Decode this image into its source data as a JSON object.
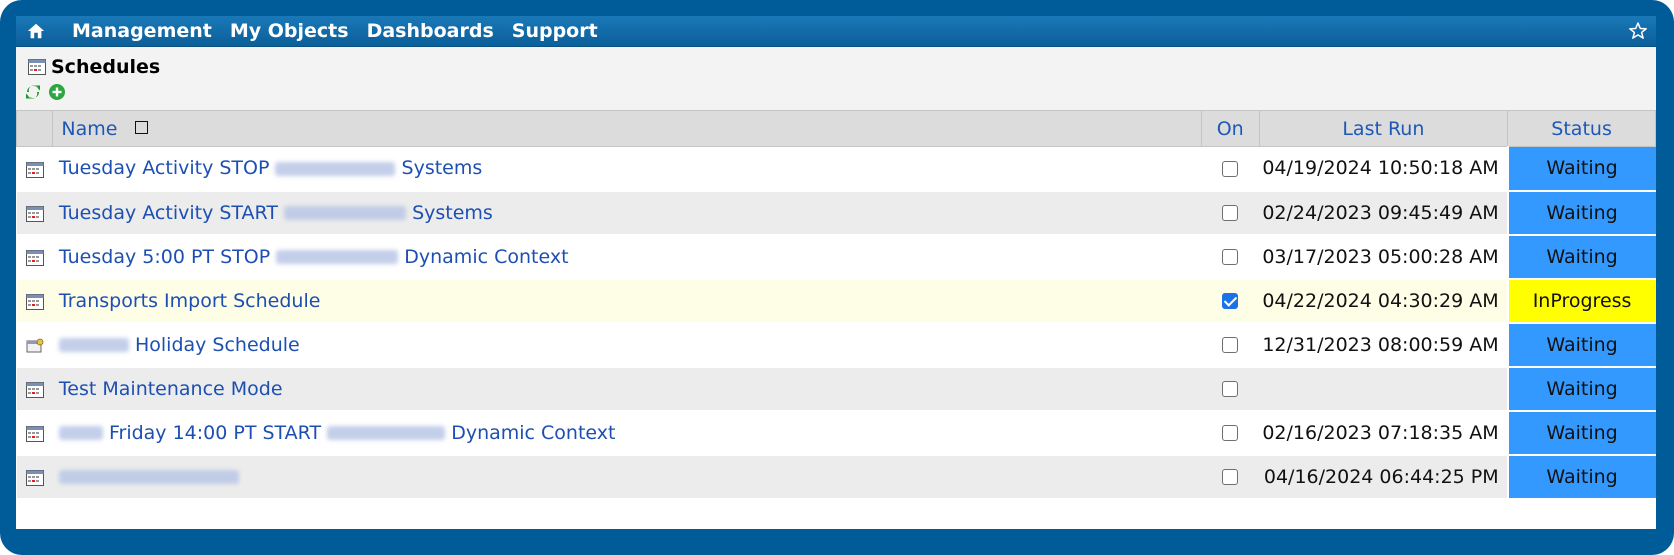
{
  "nav": {
    "items": [
      "Management",
      "My Objects",
      "Dashboards",
      "Support"
    ]
  },
  "page": {
    "title": "Schedules"
  },
  "table": {
    "headers": {
      "name": "Name",
      "on": "On",
      "last_run": "Last Run",
      "status": "Status"
    },
    "rows": [
      {
        "name_before": "Tuesday Activity STOP",
        "name_after": "Systems",
        "on": false,
        "last_run": "04/19/2024 10:50:18 AM",
        "status": "Waiting",
        "icon": "calendar-icon"
      },
      {
        "name_before": "Tuesday Activity START",
        "name_after": "Systems",
        "on": false,
        "last_run": "02/24/2023 09:45:49 AM",
        "status": "Waiting",
        "icon": "calendar-icon"
      },
      {
        "name_before": "Tuesday 5:00 PT STOP",
        "name_after": "Dynamic Context",
        "on": false,
        "last_run": "03/17/2023 05:00:28 AM",
        "status": "Waiting",
        "icon": "calendar-icon"
      },
      {
        "name_before": "Transports Import Schedule",
        "name_after": "",
        "on": true,
        "last_run": "04/22/2024 04:30:29 AM",
        "status": "InProgress",
        "icon": "calendar-icon"
      },
      {
        "name_before": "",
        "name_after": "Holiday Schedule",
        "on": false,
        "last_run": "12/31/2023 08:00:59 AM",
        "status": "Waiting",
        "icon": "holiday-calendar-icon"
      },
      {
        "name_before": "Test Maintenance Mode",
        "name_after": "",
        "on": false,
        "last_run": "",
        "status": "Waiting",
        "icon": "calendar-icon"
      },
      {
        "name_before": "",
        "name_after": "Friday 14:00 PT START",
        "name_tail": "Dynamic Context",
        "on": false,
        "last_run": "02/16/2023 07:18:35 AM",
        "status": "Waiting",
        "icon": "calendar-icon"
      },
      {
        "name_before": "",
        "name_after": "",
        "on": false,
        "last_run": "04/16/2024 06:44:25 PM",
        "status": "Waiting",
        "icon": "calendar-icon"
      }
    ]
  },
  "colors": {
    "frame": "#005b99",
    "waiting": "#3399ff",
    "in_progress": "#ffff00",
    "link": "#1d4fb3"
  }
}
